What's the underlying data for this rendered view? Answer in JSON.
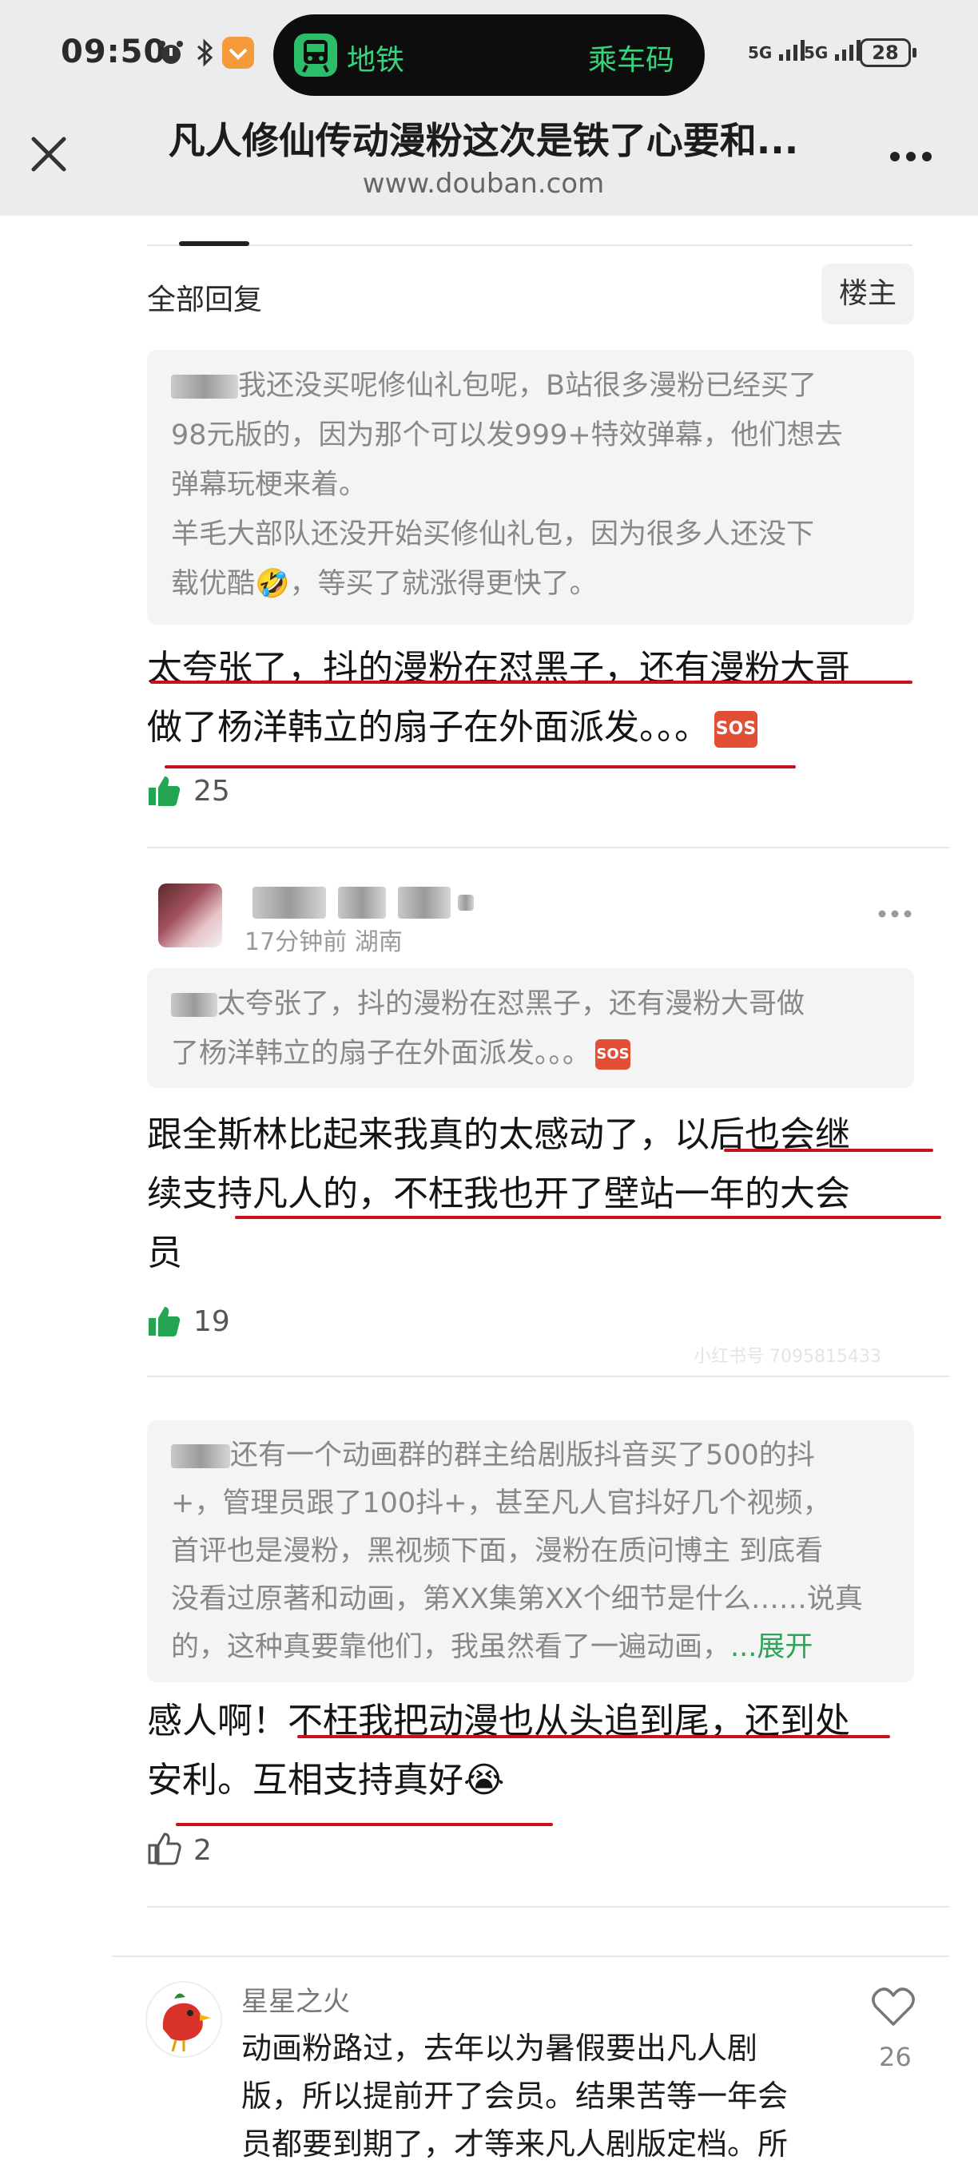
{
  "status_bar": {
    "time": "09:50",
    "island_left": "地铁",
    "island_right": "乘车码",
    "signal_1": "5G",
    "signal_2": "5G",
    "battery": "28"
  },
  "header": {
    "title": "凡人修仙传动漫粉这次是铁了心要和...",
    "url": "www.douban.com"
  },
  "section": {
    "title": "全部回复",
    "op_filter": "楼主"
  },
  "comments": [
    {
      "quote_lines": [
        "我还没买呢修仙礼包呢，B站很多漫粉已经买了",
        "98元版的，因为那个可以发999+特效弹幕，他们想去",
        "弹幕玩梗来着。",
        "羊毛大部队还没开始买修仙礼包，因为很多人还没下",
        "载优酷🤣，等买了就涨得更快了。"
      ],
      "reply_lines": [
        "太夸张了，抖的漫粉在怼黑子，还有漫粉大哥",
        "做了杨洋韩立的扇子在外面派发。。。"
      ],
      "likes": "25"
    },
    {
      "meta": "17分钟前 湖南",
      "quote_lines": [
        "太夸张了，抖的漫粉在怼黑子，还有漫粉大哥做",
        "了杨洋韩立的扇子在外面派发。。。"
      ],
      "reply_lines": [
        "跟全斯林比起来我真的太感动了，以后也会继",
        "续支持凡人的，不枉我也开了壁站一年的大会",
        "员"
      ],
      "likes": "19",
      "watermark": "小红书号 7095815433"
    },
    {
      "quote_lines": [
        "还有一个动画群的群主给剧版抖音买了500的抖",
        "+，管理员跟了100抖+，甚至凡人官抖好几个视频，",
        "首评也是漫粉，黑视频下面，漫粉在质问博主 到底看",
        "没看过原著和动画，第XX集第XX个细节是什么……说真",
        "的，这种真要靠他们，我虽然看了一遍动画，"
      ],
      "expand": "...展开",
      "reply_lines": [
        "感人啊！不枉我把动漫也从头追到尾，还到处",
        "安利。互相支持真好😭"
      ],
      "likes": "2"
    },
    {
      "username": "星星之火",
      "text_lines": [
        "动画粉路过，去年以为暑假要出凡人剧",
        "版，所以提前开了会员。结果苦等一年会",
        "员都要到期了，才等来凡人剧版定档。所"
      ],
      "likes": "26"
    }
  ],
  "colors": {
    "accent_green": "#2bbd6a",
    "underline_red": "#c8111b",
    "like_green": "#25a452"
  }
}
